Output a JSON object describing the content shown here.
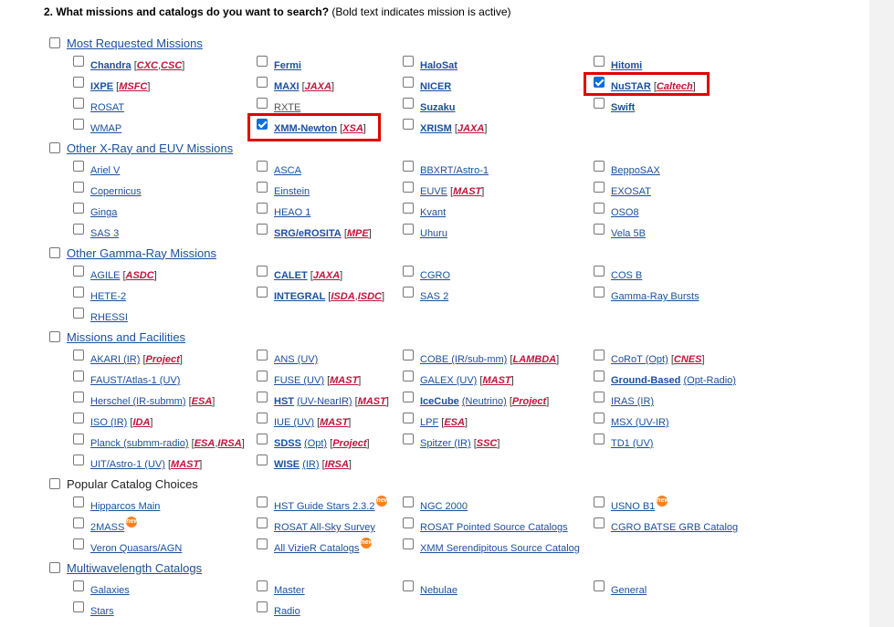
{
  "heading": {
    "number": "2.",
    "question": "What missions and catalogs do you want to search?",
    "note": "(Bold text indicates mission is active)"
  },
  "new_badge": "new",
  "groups": [
    {
      "label": "Most Requested Missions"
    },
    {
      "label": "Other X-Ray and EUV Missions"
    },
    {
      "label": "Other Gamma-Ray Missions"
    },
    {
      "label": "Missions and Facilities"
    },
    {
      "label": "Popular Catalog Choices"
    },
    {
      "label": "Multiwavelength Catalogs"
    }
  ],
  "items": {
    "chandra": {
      "name": "Chandra",
      "tags": [
        "CXC",
        "CSC"
      ]
    },
    "fermi": {
      "name": "Fermi"
    },
    "halosat": {
      "name": "HaloSat"
    },
    "hitomi": {
      "name": "Hitomi"
    },
    "ixpe": {
      "name": "IXPE",
      "tags": [
        "MSFC"
      ]
    },
    "maxi": {
      "name": "MAXI",
      "tags": [
        "JAXA"
      ]
    },
    "nicer": {
      "name": "NICER"
    },
    "nustar": {
      "name": "NuSTAR",
      "tags": [
        "Caltech"
      ]
    },
    "rosat": {
      "name": "ROSAT"
    },
    "rxte": {
      "name": "RXTE"
    },
    "suzaku": {
      "name": "Suzaku"
    },
    "swift": {
      "name": "Swift"
    },
    "wmap": {
      "name": "WMAP"
    },
    "xmm": {
      "name": "XMM-Newton",
      "tags": [
        "XSA"
      ]
    },
    "xrism": {
      "name": "XRISM",
      "tags": [
        "JAXA"
      ]
    },
    "ariel": {
      "name": "Ariel V"
    },
    "asca": {
      "name": "ASCA"
    },
    "bbxrt": {
      "name": "BBXRT/Astro-1"
    },
    "beppo": {
      "name": "BeppoSAX"
    },
    "copernicus": {
      "name": "Copernicus"
    },
    "einstein": {
      "name": "Einstein"
    },
    "euve": {
      "name": "EUVE",
      "tags": [
        "MAST"
      ]
    },
    "exosat": {
      "name": "EXOSAT"
    },
    "ginga": {
      "name": "Ginga"
    },
    "heao1": {
      "name": "HEAO 1"
    },
    "kvant": {
      "name": "Kvant"
    },
    "oso8": {
      "name": "OSO8"
    },
    "sas3": {
      "name": "SAS 3"
    },
    "srg": {
      "name": "SRG/eROSITA",
      "tags": [
        "MPE"
      ]
    },
    "uhuru": {
      "name": "Uhuru"
    },
    "vela": {
      "name": "Vela 5B"
    },
    "agile": {
      "name": "AGILE",
      "tags": [
        "ASDC"
      ]
    },
    "calet": {
      "name": "CALET",
      "tags": [
        "JAXA"
      ]
    },
    "cgro": {
      "name": "CGRO"
    },
    "cosb": {
      "name": "COS B"
    },
    "hete": {
      "name": "HETE-2"
    },
    "integral": {
      "name": "INTEGRAL",
      "tags": [
        "ISDA",
        "ISDC"
      ]
    },
    "sas2": {
      "name": "SAS 2"
    },
    "grb": {
      "name": "Gamma-Ray Bursts"
    },
    "rhessi": {
      "name": "RHESSI"
    },
    "akari": {
      "name": "AKARI (IR)",
      "tags": [
        "Project"
      ]
    },
    "ans": {
      "name": "ANS (UV)"
    },
    "cobe": {
      "name": "COBE (IR/sub-mm)",
      "tags": [
        "LAMBDA"
      ]
    },
    "corot": {
      "name": "CoRoT (Opt)",
      "tags": [
        "CNES"
      ]
    },
    "faust": {
      "name": "FAUST/Atlas-1 (UV)"
    },
    "fuse": {
      "name": "FUSE (UV)",
      "tags": [
        "MAST"
      ]
    },
    "galex": {
      "name": "GALEX (UV)",
      "tags": [
        "MAST"
      ]
    },
    "ground": {
      "name": "Ground-Based",
      "extra": "(Opt-Radio)"
    },
    "herschel": {
      "name": "Herschel (IR-submm)",
      "tags": [
        "ESA"
      ]
    },
    "hst": {
      "name": "HST",
      "extra": "(UV-NearIR)",
      "tags": [
        "MAST"
      ]
    },
    "icecube": {
      "name": "IceCube",
      "extra": "(Neutrino)",
      "tags": [
        "Project"
      ]
    },
    "iras": {
      "name": "IRAS (IR)"
    },
    "iso": {
      "name": "ISO (IR)",
      "tags": [
        "IDA"
      ]
    },
    "iue": {
      "name": "IUE (UV)",
      "tags": [
        "MAST"
      ]
    },
    "lpf": {
      "name": "LPF",
      "tags": [
        "ESA"
      ]
    },
    "msx": {
      "name": "MSX (UV-IR)"
    },
    "planck": {
      "name": "Planck (submm-radio)",
      "tags": [
        "ESA",
        "IRSA"
      ]
    },
    "sdss": {
      "name": "SDSS",
      "extra": "(Opt)",
      "tags": [
        "Project"
      ]
    },
    "spitzer": {
      "name": "Spitzer (IR)",
      "tags": [
        "SSC"
      ]
    },
    "td1": {
      "name": "TD1 (UV)"
    },
    "uit": {
      "name": "UIT/Astro-1 (UV)",
      "tags": [
        "MAST"
      ]
    },
    "wise": {
      "name": "WISE",
      "extra": "(IR)",
      "tags": [
        "IRSA"
      ]
    },
    "hipparcos": {
      "name": "Hipparcos Main"
    },
    "hstguide": {
      "name": "HST Guide Stars 2.3.2"
    },
    "ngc": {
      "name": "NGC 2000"
    },
    "usno": {
      "name": "USNO B1"
    },
    "twomass": {
      "name": "2MASS"
    },
    "rass": {
      "name": "ROSAT All-Sky Survey"
    },
    "rosatpt": {
      "name": "ROSAT Pointed Source Catalogs"
    },
    "batse": {
      "name": "CGRO BATSE GRB Catalog"
    },
    "veron": {
      "name": "Veron Quasars/AGN"
    },
    "vizier": {
      "name": "All VizieR Catalogs"
    },
    "xmmser": {
      "name": "XMM Serendipitous Source Catalog"
    },
    "galaxies": {
      "name": "Galaxies"
    },
    "master": {
      "name": "Master"
    },
    "nebulae": {
      "name": "Nebulae"
    },
    "general": {
      "name": "General"
    },
    "stars": {
      "name": "Stars"
    },
    "radio": {
      "name": "Radio"
    }
  }
}
